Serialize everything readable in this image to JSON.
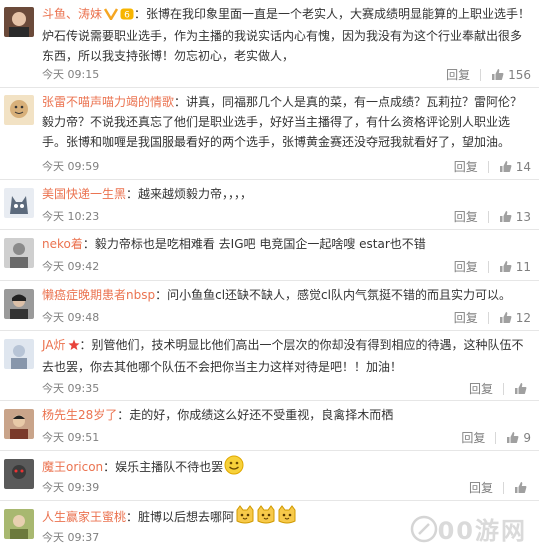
{
  "comments": [
    {
      "user": "斗鱼、涛妹",
      "text": "：张博在我印象里面一直是一个老实人，大赛成绩明显能算的上职业选手！炉石传说需要职业选手，作为主播的我说实话内心有愧，因为我没有为这个行业奉献出很多东西，所以我支持张博！勿忘初心，老实做人，",
      "time": "今天 09:15",
      "reply": "回复",
      "likes": "156",
      "avatar_color": "#6b4a3a"
    },
    {
      "user": "张雷不喵声喵力竭的情歌",
      "text": "：讲真，同福那几个人是真的菜，有一点成绩？瓦莉拉？雷阿伦？毅力帝？不说我还真忘了他们是职业选手，好好当主播得了，有什么资格评论别人职业选手。张博和咖喱是我国服最看好的两个选手，张博黄金赛还没夺冠我就看好了，望加油。",
      "time": "今天 09:59",
      "reply": "回复",
      "likes": "14",
      "avatar_color": "#d8b07a"
    },
    {
      "user": "美国快递一生黑",
      "text": "：越来越烦毅力帝，，，，",
      "time": "今天 10:23",
      "reply": "回复",
      "likes": "13",
      "avatar_color": "#5c6a7c"
    },
    {
      "user": "neko着",
      "text": "：毅力帝标也是吃相难看   去IG吧 电竞国企一起啥嗖 estar也不错",
      "time": "今天 09:42",
      "reply": "回复",
      "likes": "11",
      "avatar_color": "#8a8a8a"
    },
    {
      "user": "懒癌症晚期患者nbsp",
      "text": "：问小鱼鱼cl还缺不缺人，感觉cl队内气氛挺不错的而且实力可以。",
      "time": "今天 09:48",
      "reply": "回复",
      "likes": "12",
      "avatar_color": "#4a4a4a"
    },
    {
      "user": "JA炘",
      "text": "：别管他们，技术明显比他们高出一个层次的你却没有得到相应的待遇，这种队伍不去也罢，你去其他哪个队伍不会把你当主力这样对待是吧！！加油！",
      "time": "今天 09:35",
      "reply": "回复",
      "likes": "",
      "avatar_color": "#b7c4d6"
    },
    {
      "user": "杨先生28岁了",
      "text": "：走的好，你成绩这么好还不受重视，良禽择木而栖",
      "time": "今天 09:51",
      "reply": "回复",
      "likes": "9",
      "avatar_color": "#7a3a2a"
    },
    {
      "user": "魔王oricon",
      "text": "：娱乐主播队不待也罢",
      "time": "今天 09:39",
      "reply": "回复",
      "likes": "",
      "avatar_color": "#3a3a3a"
    },
    {
      "user": "人生赢家王蜜桃",
      "text": "：脏博以后想去哪阿",
      "time": "今天 09:37",
      "reply": "回复",
      "likes": "",
      "avatar_color": "#6c7a3c"
    }
  ],
  "watermark": "00游网"
}
